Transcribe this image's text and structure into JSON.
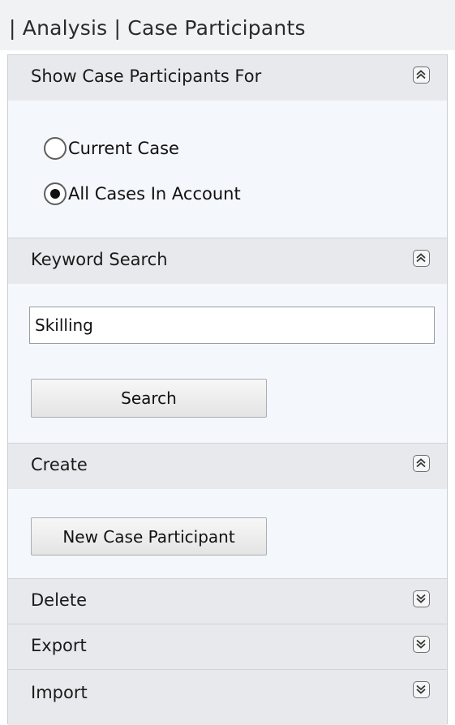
{
  "breadcrumb": "| Analysis | Case Participants",
  "sections": {
    "show_for": {
      "title": "Show Case Participants For",
      "expanded": true,
      "options": [
        {
          "label": "Current Case",
          "checked": false
        },
        {
          "label": "All Cases In Account",
          "checked": true
        }
      ]
    },
    "keyword": {
      "title": "Keyword Search",
      "expanded": true,
      "input_value": "Skilling",
      "button_label": "Search"
    },
    "create": {
      "title": "Create",
      "expanded": true,
      "button_label": "New Case Participant"
    },
    "delete": {
      "title": "Delete",
      "expanded": false
    },
    "export": {
      "title": "Export",
      "expanded": false
    },
    "import": {
      "title": "Import",
      "expanded": false
    }
  },
  "icons": {
    "expanded": "chevron-double-up-icon",
    "collapsed": "chevron-double-down-icon"
  }
}
